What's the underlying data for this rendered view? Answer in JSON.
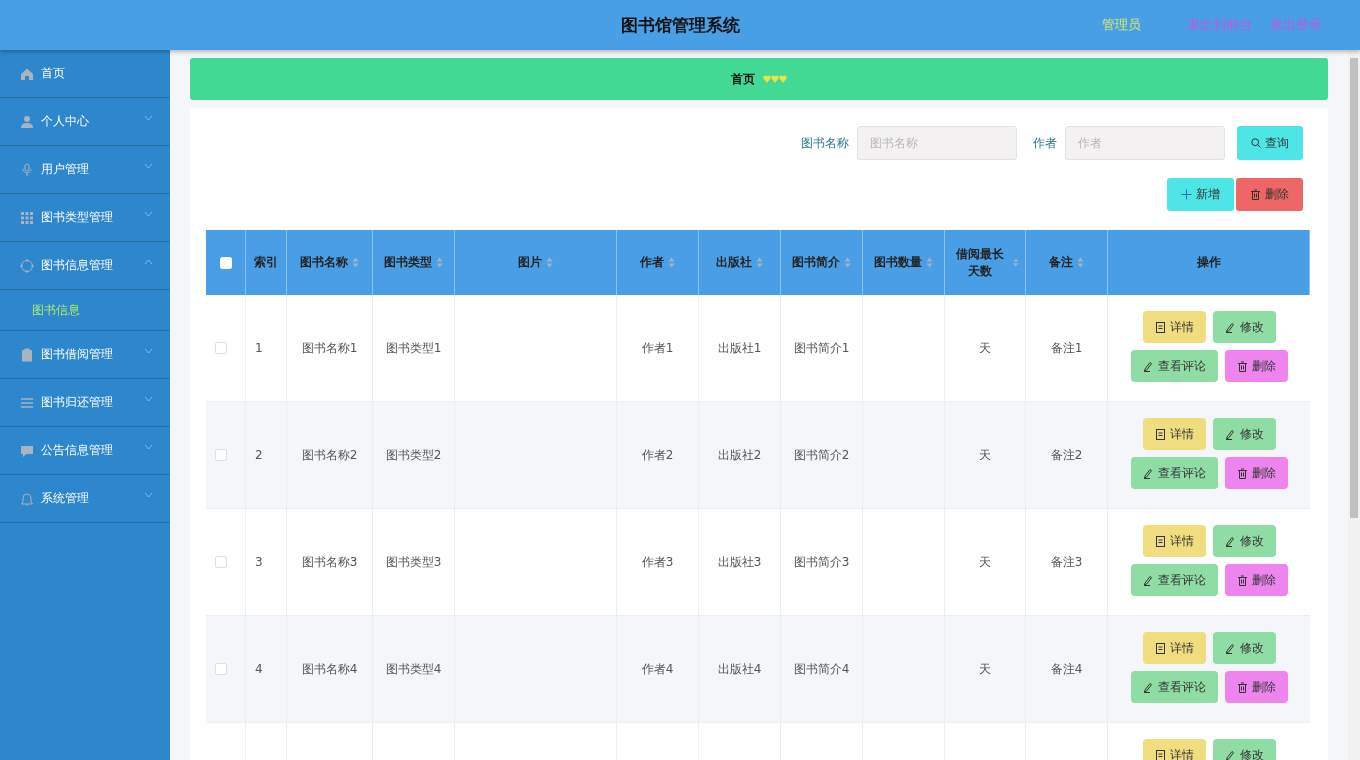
{
  "header": {
    "title": "图书馆管理系统",
    "user": "管理员",
    "links": [
      "退出到前台",
      "退出登录"
    ]
  },
  "sidebar": {
    "items": [
      {
        "label": "首页"
      },
      {
        "label": "个人中心",
        "expanded": false
      },
      {
        "label": "用户管理",
        "expanded": false
      },
      {
        "label": "图书类型管理",
        "expanded": false
      },
      {
        "label": "图书信息管理",
        "expanded": true,
        "children": [
          {
            "label": "图书信息",
            "selected": true
          }
        ]
      },
      {
        "label": "图书借阅管理",
        "expanded": false
      },
      {
        "label": "图书归还管理",
        "expanded": false
      },
      {
        "label": "公告信息管理",
        "expanded": false
      },
      {
        "label": "系统管理",
        "expanded": false
      }
    ]
  },
  "breadcrumb": {
    "items": [
      "首页"
    ]
  },
  "search": {
    "fields": [
      {
        "label": "图书名称",
        "placeholder": "图书名称"
      },
      {
        "label": "作者",
        "placeholder": "作者"
      }
    ],
    "button": "查询"
  },
  "actions": [
    {
      "kind": "add",
      "label": "新增"
    },
    {
      "kind": "delete",
      "label": "删除"
    }
  ],
  "table": {
    "all_checked": false,
    "columns": [
      {
        "label": "索引",
        "sortable": false
      },
      {
        "label": "图书名称",
        "sortable": true
      },
      {
        "label": "图书类型",
        "sortable": true
      },
      {
        "label": "图片",
        "sortable": true
      },
      {
        "label": "作者",
        "sortable": true
      },
      {
        "label": "出版社",
        "sortable": true
      },
      {
        "label": "图书简介",
        "sortable": true
      },
      {
        "label": "图书数量",
        "sortable": true
      },
      {
        "label": "借阅最长天数",
        "sortable": true
      },
      {
        "label": "备注",
        "sortable": true
      },
      {
        "label": "操作",
        "sortable": false
      }
    ],
    "rows": [
      {
        "checked": false,
        "cells": [
          "1",
          "图书名称1",
          "图书类型1",
          null,
          "作者1",
          "出版社1",
          "图书简介1",
          null,
          "天",
          "备注1"
        ],
        "buttons": [
          {
            "kind": "detail",
            "label": "详情"
          },
          {
            "kind": "edit",
            "label": "修改"
          },
          {
            "kind": "comment",
            "label": "查看评论"
          },
          {
            "kind": "delete",
            "label": "删除"
          }
        ]
      },
      {
        "checked": false,
        "cells": [
          "2",
          "图书名称2",
          "图书类型2",
          null,
          "作者2",
          "出版社2",
          "图书简介2",
          null,
          "天",
          "备注2"
        ],
        "buttons": [
          {
            "kind": "detail",
            "label": "详情"
          },
          {
            "kind": "edit",
            "label": "修改"
          },
          {
            "kind": "comment",
            "label": "查看评论"
          },
          {
            "kind": "delete",
            "label": "删除"
          }
        ]
      },
      {
        "checked": false,
        "cells": [
          "3",
          "图书名称3",
          "图书类型3",
          null,
          "作者3",
          "出版社3",
          "图书简介3",
          null,
          "天",
          "备注3"
        ],
        "buttons": [
          {
            "kind": "detail",
            "label": "详情"
          },
          {
            "kind": "edit",
            "label": "修改"
          },
          {
            "kind": "comment",
            "label": "查看评论"
          },
          {
            "kind": "delete",
            "label": "删除"
          }
        ]
      },
      {
        "checked": false,
        "cells": [
          "4",
          "图书名称4",
          "图书类型4",
          null,
          "作者4",
          "出版社4",
          "图书简介4",
          null,
          "天",
          "备注4"
        ],
        "buttons": [
          {
            "kind": "detail",
            "label": "详情"
          },
          {
            "kind": "edit",
            "label": "修改"
          },
          {
            "kind": "comment",
            "label": "查看评论"
          },
          {
            "kind": "delete",
            "label": "删除"
          }
        ]
      },
      {
        "buttons": [
          {
            "kind": "detail",
            "label": "详情"
          },
          {
            "kind": "edit",
            "label": "修改"
          }
        ]
      }
    ]
  }
}
